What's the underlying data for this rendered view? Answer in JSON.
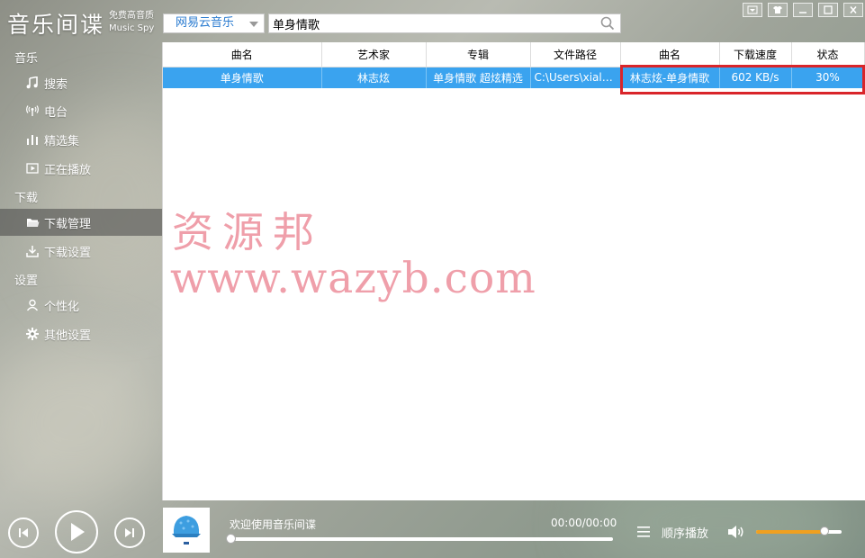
{
  "app": {
    "title": "音乐间谍",
    "subtitle_line1": "免费高音质",
    "subtitle_line2": "Music Spy"
  },
  "header": {
    "source": "网易云音乐",
    "search_value": "单身情歌",
    "search_placeholder": ""
  },
  "sidebar": {
    "sections": [
      {
        "title": "音乐",
        "items": [
          {
            "label": "搜索",
            "icon": "search-icon"
          },
          {
            "label": "电台",
            "icon": "radio-icon"
          },
          {
            "label": "精选集",
            "icon": "bars-icon"
          },
          {
            "label": "正在播放",
            "icon": "play-box-icon"
          }
        ]
      },
      {
        "title": "下载",
        "items": [
          {
            "label": "下载管理",
            "icon": "folder-icon",
            "active": true
          },
          {
            "label": "下载设置",
            "icon": "download-icon"
          }
        ]
      },
      {
        "title": "设置",
        "items": [
          {
            "label": "个性化",
            "icon": "person-icon"
          },
          {
            "label": "其他设置",
            "icon": "gear-icon"
          }
        ]
      }
    ]
  },
  "table": {
    "headers": [
      "曲名",
      "艺术家",
      "专辑",
      "文件路径",
      "曲名",
      "下载速度",
      "状态"
    ],
    "rows": [
      [
        "单身情歌",
        "林志炫",
        "单身情歌 超炫精选",
        "C:\\Users\\xiale...",
        "林志炫-单身情歌",
        "602 KB/s",
        "30%"
      ]
    ]
  },
  "watermark": {
    "line1": "资源邦",
    "line2": "www.wazyb.com"
  },
  "player": {
    "now_playing": "欢迎使用音乐间谍",
    "time": "00:00/00:00",
    "progress": 0,
    "mode": "顺序播放",
    "volume": 0.8
  },
  "colors": {
    "accent": "#2a7bd0",
    "row_selected": "#3aa3ef",
    "highlight_box": "#d9252a",
    "watermark": "#ef9aa6",
    "volume_fill": "#f0a020"
  }
}
